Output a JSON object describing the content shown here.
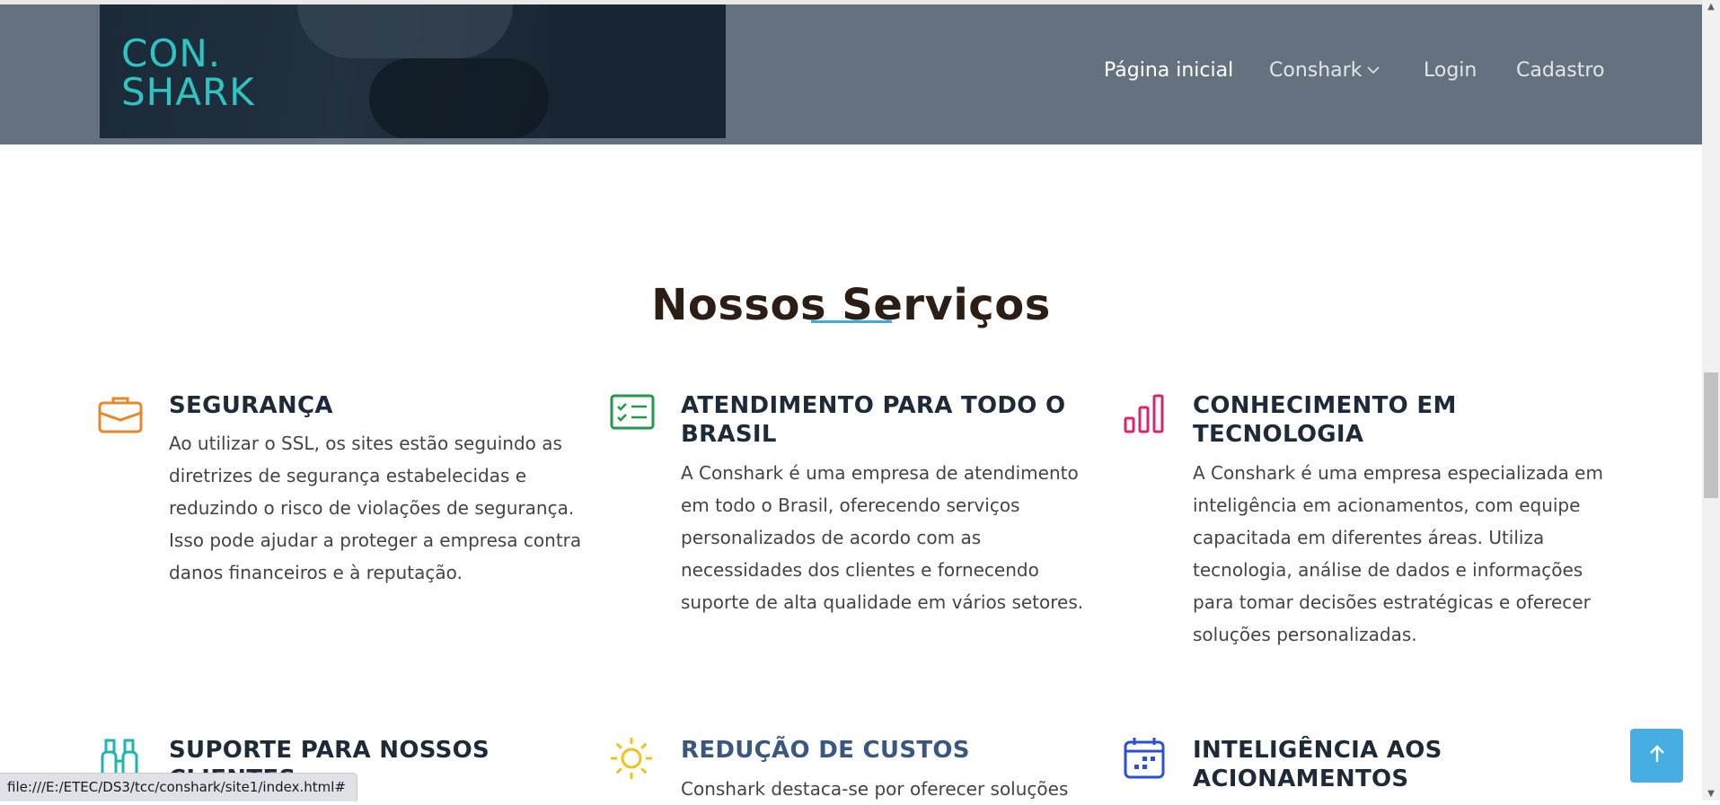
{
  "brand": {
    "logo_line1": "CON.",
    "logo_line2": "SHARK"
  },
  "nav": {
    "items": [
      {
        "label": "Página inicial"
      },
      {
        "label": "Conshark"
      },
      {
        "label": "Login"
      },
      {
        "label": "Cadastro"
      }
    ]
  },
  "section": {
    "title": "Nossos Serviços"
  },
  "services": [
    {
      "icon": "briefcase-icon",
      "color": "#e98727",
      "title_lines": [
        "SEGURANÇA"
      ],
      "text_lines": [
        "Ao utilizar o SSL, os sites estão seguindo as",
        "diretrizes de segurança estabelecidas e",
        "reduzindo o risco de violações de segurança.",
        "Isso pode ajudar a proteger a empresa contra",
        "danos financeiros e à reputação."
      ]
    },
    {
      "icon": "checklist-icon",
      "color": "#1f9a4c",
      "title_lines": [
        "ATENDIMENTO PARA TODO O",
        "BRASIL"
      ],
      "text_lines": [
        "A Conshark é uma empresa de atendimento",
        "em todo o Brasil, oferecendo serviços",
        "personalizados de acordo com as",
        "necessidades dos clientes e fornecendo",
        "suporte de alta qualidade em vários setores."
      ]
    },
    {
      "icon": "bar-chart-icon",
      "color": "#d8256e",
      "title_lines": [
        "CONHECIMENTO EM",
        "TECNOLOGIA"
      ],
      "text_lines": [
        "A Conshark é uma empresa especializada em",
        "inteligência em acionamentos, com equipe",
        "capacitada em diferentes áreas. Utiliza",
        "tecnologia, análise de dados e informações",
        "para tomar decisões estratégicas e oferecer",
        "soluções personalizadas."
      ]
    },
    {
      "icon": "binoculars-icon",
      "color": "#1cb5b5",
      "title_lines": [
        "SUPORTE PARA NOSSOS",
        "CLIENTES"
      ],
      "text_lines": []
    },
    {
      "icon": "sun-icon",
      "color": "#f2c21b",
      "title_lines": [
        "REDUÇÃO DE CUSTOS"
      ],
      "text_lines": [
        "Conshark destaca-se por oferecer soluções"
      ]
    },
    {
      "icon": "calendar-icon",
      "color": "#2b4fd6",
      "title_lines": [
        "INTELIGÊNCIA AOS",
        "ACIONAMENTOS"
      ],
      "text_lines": []
    }
  ],
  "status_bar": {
    "url": "file:///E:/ETEC/DS3/tcc/conshark/site1/index.html#"
  }
}
